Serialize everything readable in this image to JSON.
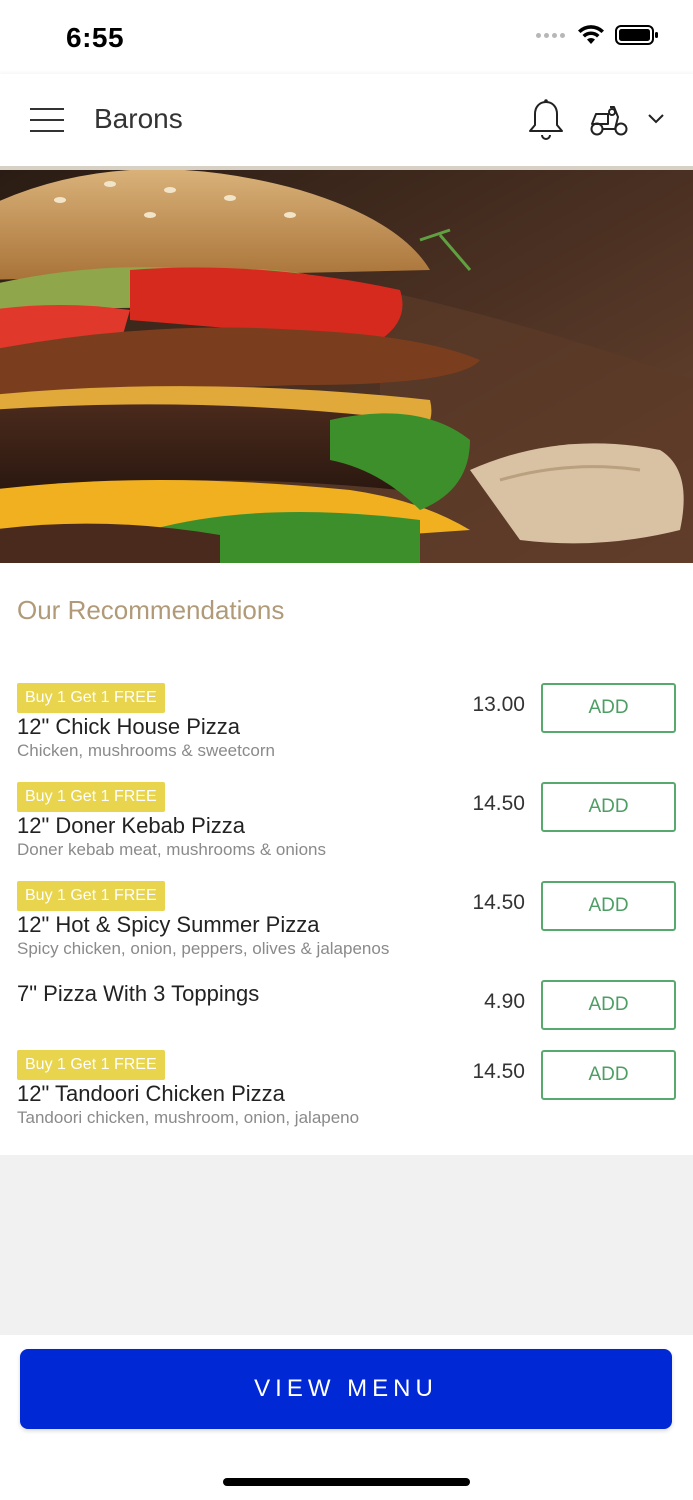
{
  "status_bar": {
    "time": "6:55",
    "icons": [
      "signal-icon",
      "wifi-icon",
      "battery-icon"
    ]
  },
  "header": {
    "title": "Barons",
    "icons": [
      "hamburger-menu-icon",
      "bell-icon",
      "scooter-delivery-icon",
      "chevron-down-icon"
    ]
  },
  "hero": {
    "image": "burger-photo"
  },
  "recommendations": {
    "title": "Our Recommendations",
    "items": [
      {
        "badge": "Buy 1 Get 1 FREE",
        "name": "12\" Chick House Pizza",
        "description": "Chicken, mushrooms & sweetcorn",
        "price": "13.00",
        "button": "ADD"
      },
      {
        "badge": "Buy 1 Get 1 FREE",
        "name": "12\" Doner Kebab Pizza",
        "description": "Doner kebab meat, mushrooms & onions",
        "price": "14.50",
        "button": "ADD"
      },
      {
        "badge": "Buy 1 Get 1 FREE",
        "name": "12\" Hot & Spicy Summer Pizza",
        "description": "Spicy chicken, onion, peppers, olives & jalapenos",
        "price": "14.50",
        "button": "ADD"
      },
      {
        "badge": "",
        "name": "7\" Pizza With 3 Toppings",
        "description": "",
        "price": "4.90",
        "button": "ADD"
      },
      {
        "badge": "Buy 1 Get 1 FREE",
        "name": "12\" Tandoori Chicken Pizza",
        "description": "Tandoori chicken, mushroom, onion, jalapeno",
        "price": "14.50",
        "button": "ADD"
      }
    ]
  },
  "footer": {
    "view_menu_label": "VIEW MENU"
  },
  "colors": {
    "accent_blue": "#0029d5",
    "add_green": "#59a86e",
    "badge_yellow": "#e8d44d",
    "section_title_tan": "#b09a78"
  }
}
